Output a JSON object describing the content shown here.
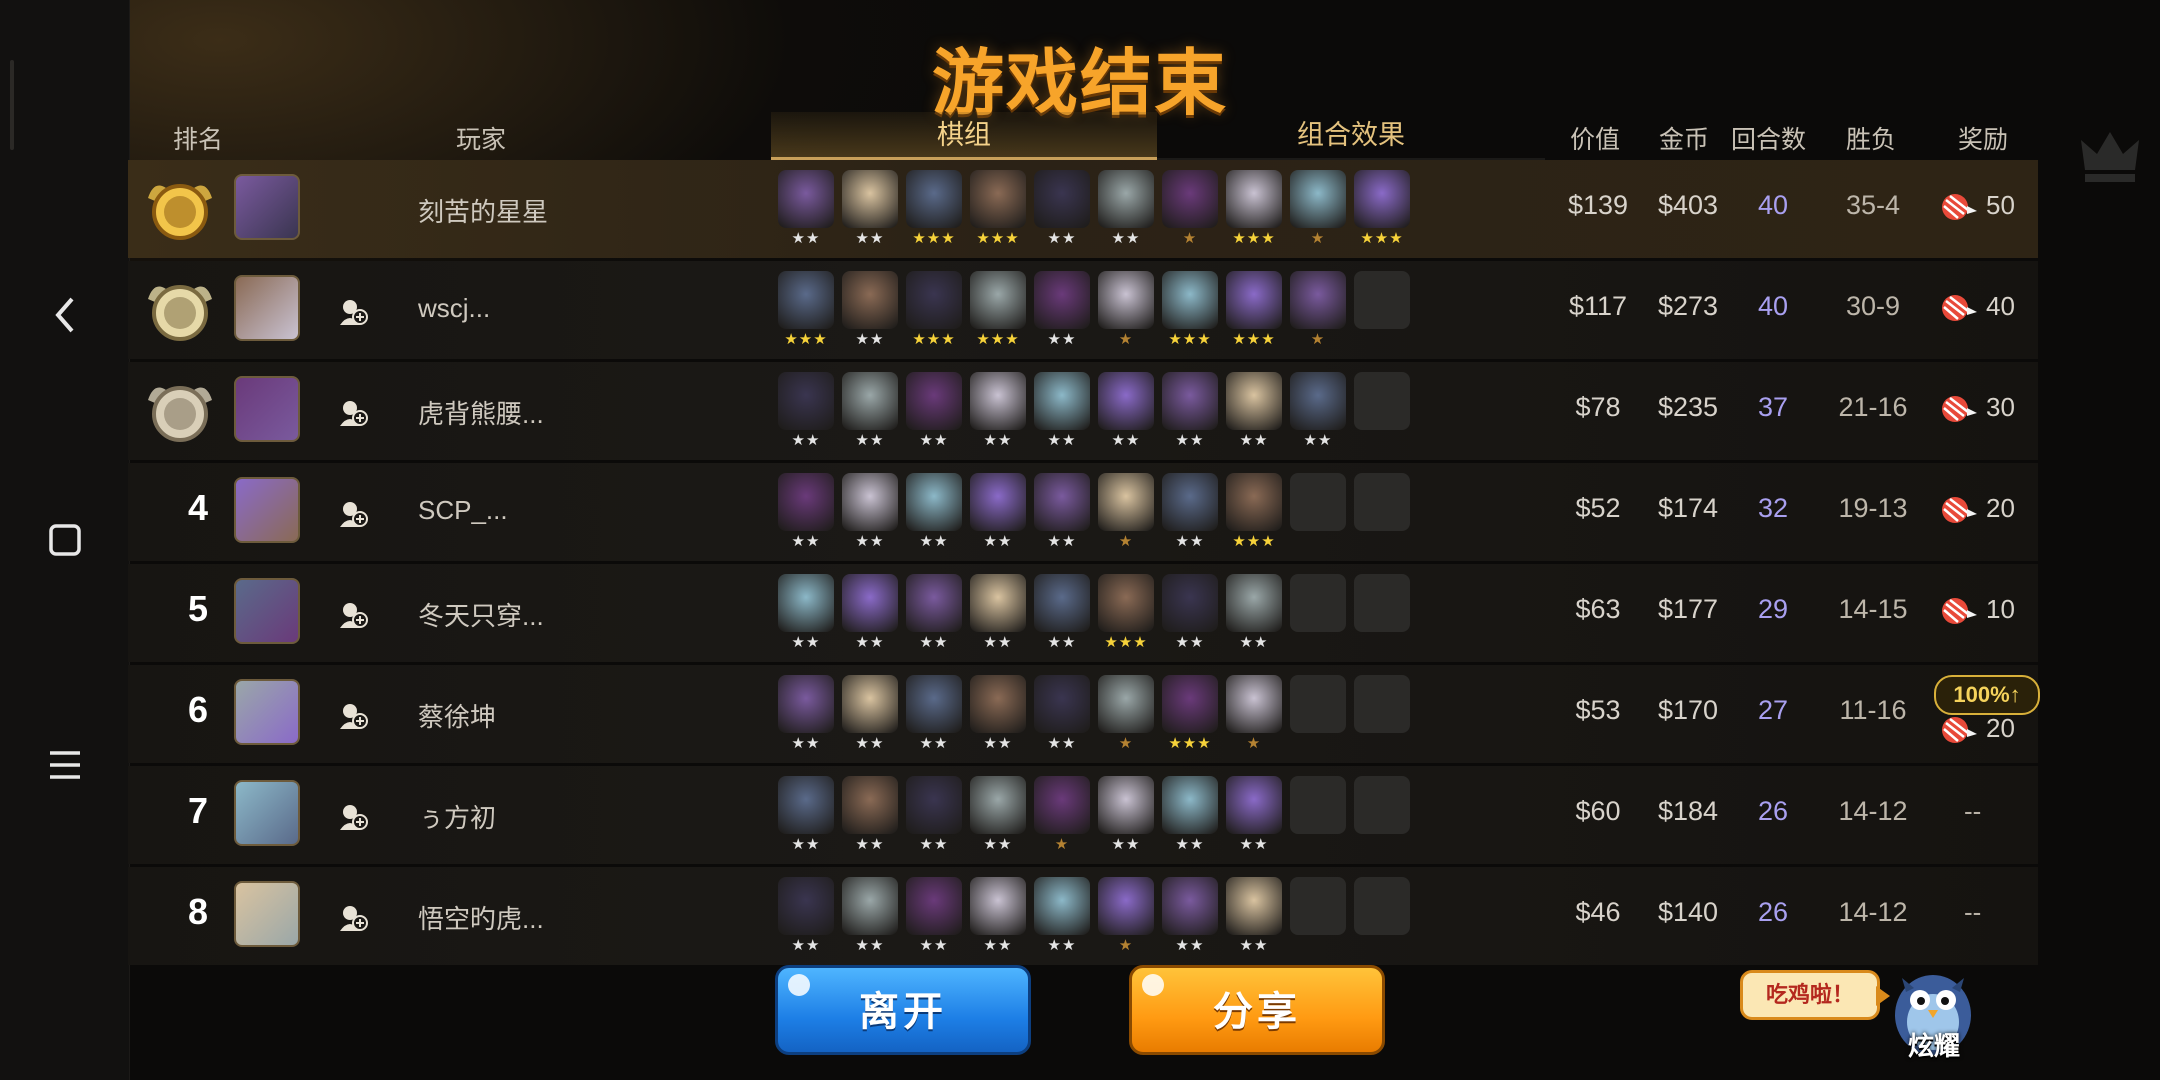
{
  "title": "游戏结束",
  "headers": {
    "rank": "排名",
    "player": "玩家",
    "tab_pieces": "棋组",
    "tab_combos": "组合效果",
    "value": "价值",
    "gold": "金币",
    "rounds": "回合数",
    "winloss": "胜负",
    "reward": "奖励"
  },
  "rows": [
    {
      "rank": "1",
      "name": "刻苦的星星",
      "value": "$139",
      "gold": "$403",
      "rounds": "40",
      "wl": "35-4",
      "reward": "50",
      "pieces": [
        2,
        2,
        3,
        3,
        2,
        2,
        1,
        3,
        1,
        3
      ]
    },
    {
      "rank": "2",
      "name": "wscj...",
      "value": "$117",
      "gold": "$273",
      "rounds": "40",
      "wl": "30-9",
      "reward": "40",
      "pieces": [
        3,
        2,
        3,
        3,
        2,
        1,
        3,
        3,
        1,
        0
      ]
    },
    {
      "rank": "3",
      "name": "虎背熊腰...",
      "value": "$78",
      "gold": "$235",
      "rounds": "37",
      "wl": "21-16",
      "reward": "30",
      "pieces": [
        2,
        2,
        2,
        2,
        2,
        2,
        2,
        2,
        2,
        0
      ]
    },
    {
      "rank": "4",
      "name": "SCP_...",
      "value": "$52",
      "gold": "$174",
      "rounds": "32",
      "wl": "19-13",
      "reward": "20",
      "pieces": [
        2,
        2,
        2,
        2,
        2,
        1,
        2,
        3,
        0,
        0
      ]
    },
    {
      "rank": "5",
      "name": "冬天只穿...",
      "value": "$63",
      "gold": "$177",
      "rounds": "29",
      "wl": "14-15",
      "reward": "10",
      "pieces": [
        2,
        2,
        2,
        2,
        2,
        3,
        2,
        2,
        0,
        0
      ]
    },
    {
      "rank": "6",
      "name": "蔡徐坤",
      "value": "$53",
      "gold": "$170",
      "rounds": "27",
      "wl": "11-16",
      "reward": "20",
      "boost": "100%↑",
      "pieces": [
        2,
        2,
        2,
        2,
        2,
        1,
        3,
        1,
        0,
        0
      ]
    },
    {
      "rank": "7",
      "name": "ぅ方初",
      "value": "$60",
      "gold": "$184",
      "rounds": "26",
      "wl": "14-12",
      "reward": "--",
      "pieces": [
        2,
        2,
        2,
        2,
        1,
        2,
        2,
        2,
        0,
        0
      ]
    },
    {
      "rank": "8",
      "name": "悟空旳虎...",
      "value": "$46",
      "gold": "$140",
      "rounds": "26",
      "wl": "14-12",
      "reward": "--",
      "pieces": [
        2,
        2,
        2,
        2,
        2,
        1,
        2,
        2,
        0,
        0
      ]
    }
  ],
  "buttons": {
    "leave": "离开",
    "share": "分享"
  },
  "bubble": "吃鸡啦！",
  "mascot_label": "炫耀",
  "colors": {
    "accent": "#f7a42a",
    "rounds": "#a9a0f0",
    "star_gold": "#f6d23a",
    "star_silver": "#e4e4e4",
    "star_bronze": "#b48232"
  },
  "piece_colors": [
    "#7a5a9e",
    "#d9c3a0",
    "#5a6a8a",
    "#8a6a55",
    "#3a3550",
    "#9aa7a8",
    "#6a3a7a",
    "#c9c2d2",
    "#8cb8c8",
    "#8a6ac8"
  ]
}
